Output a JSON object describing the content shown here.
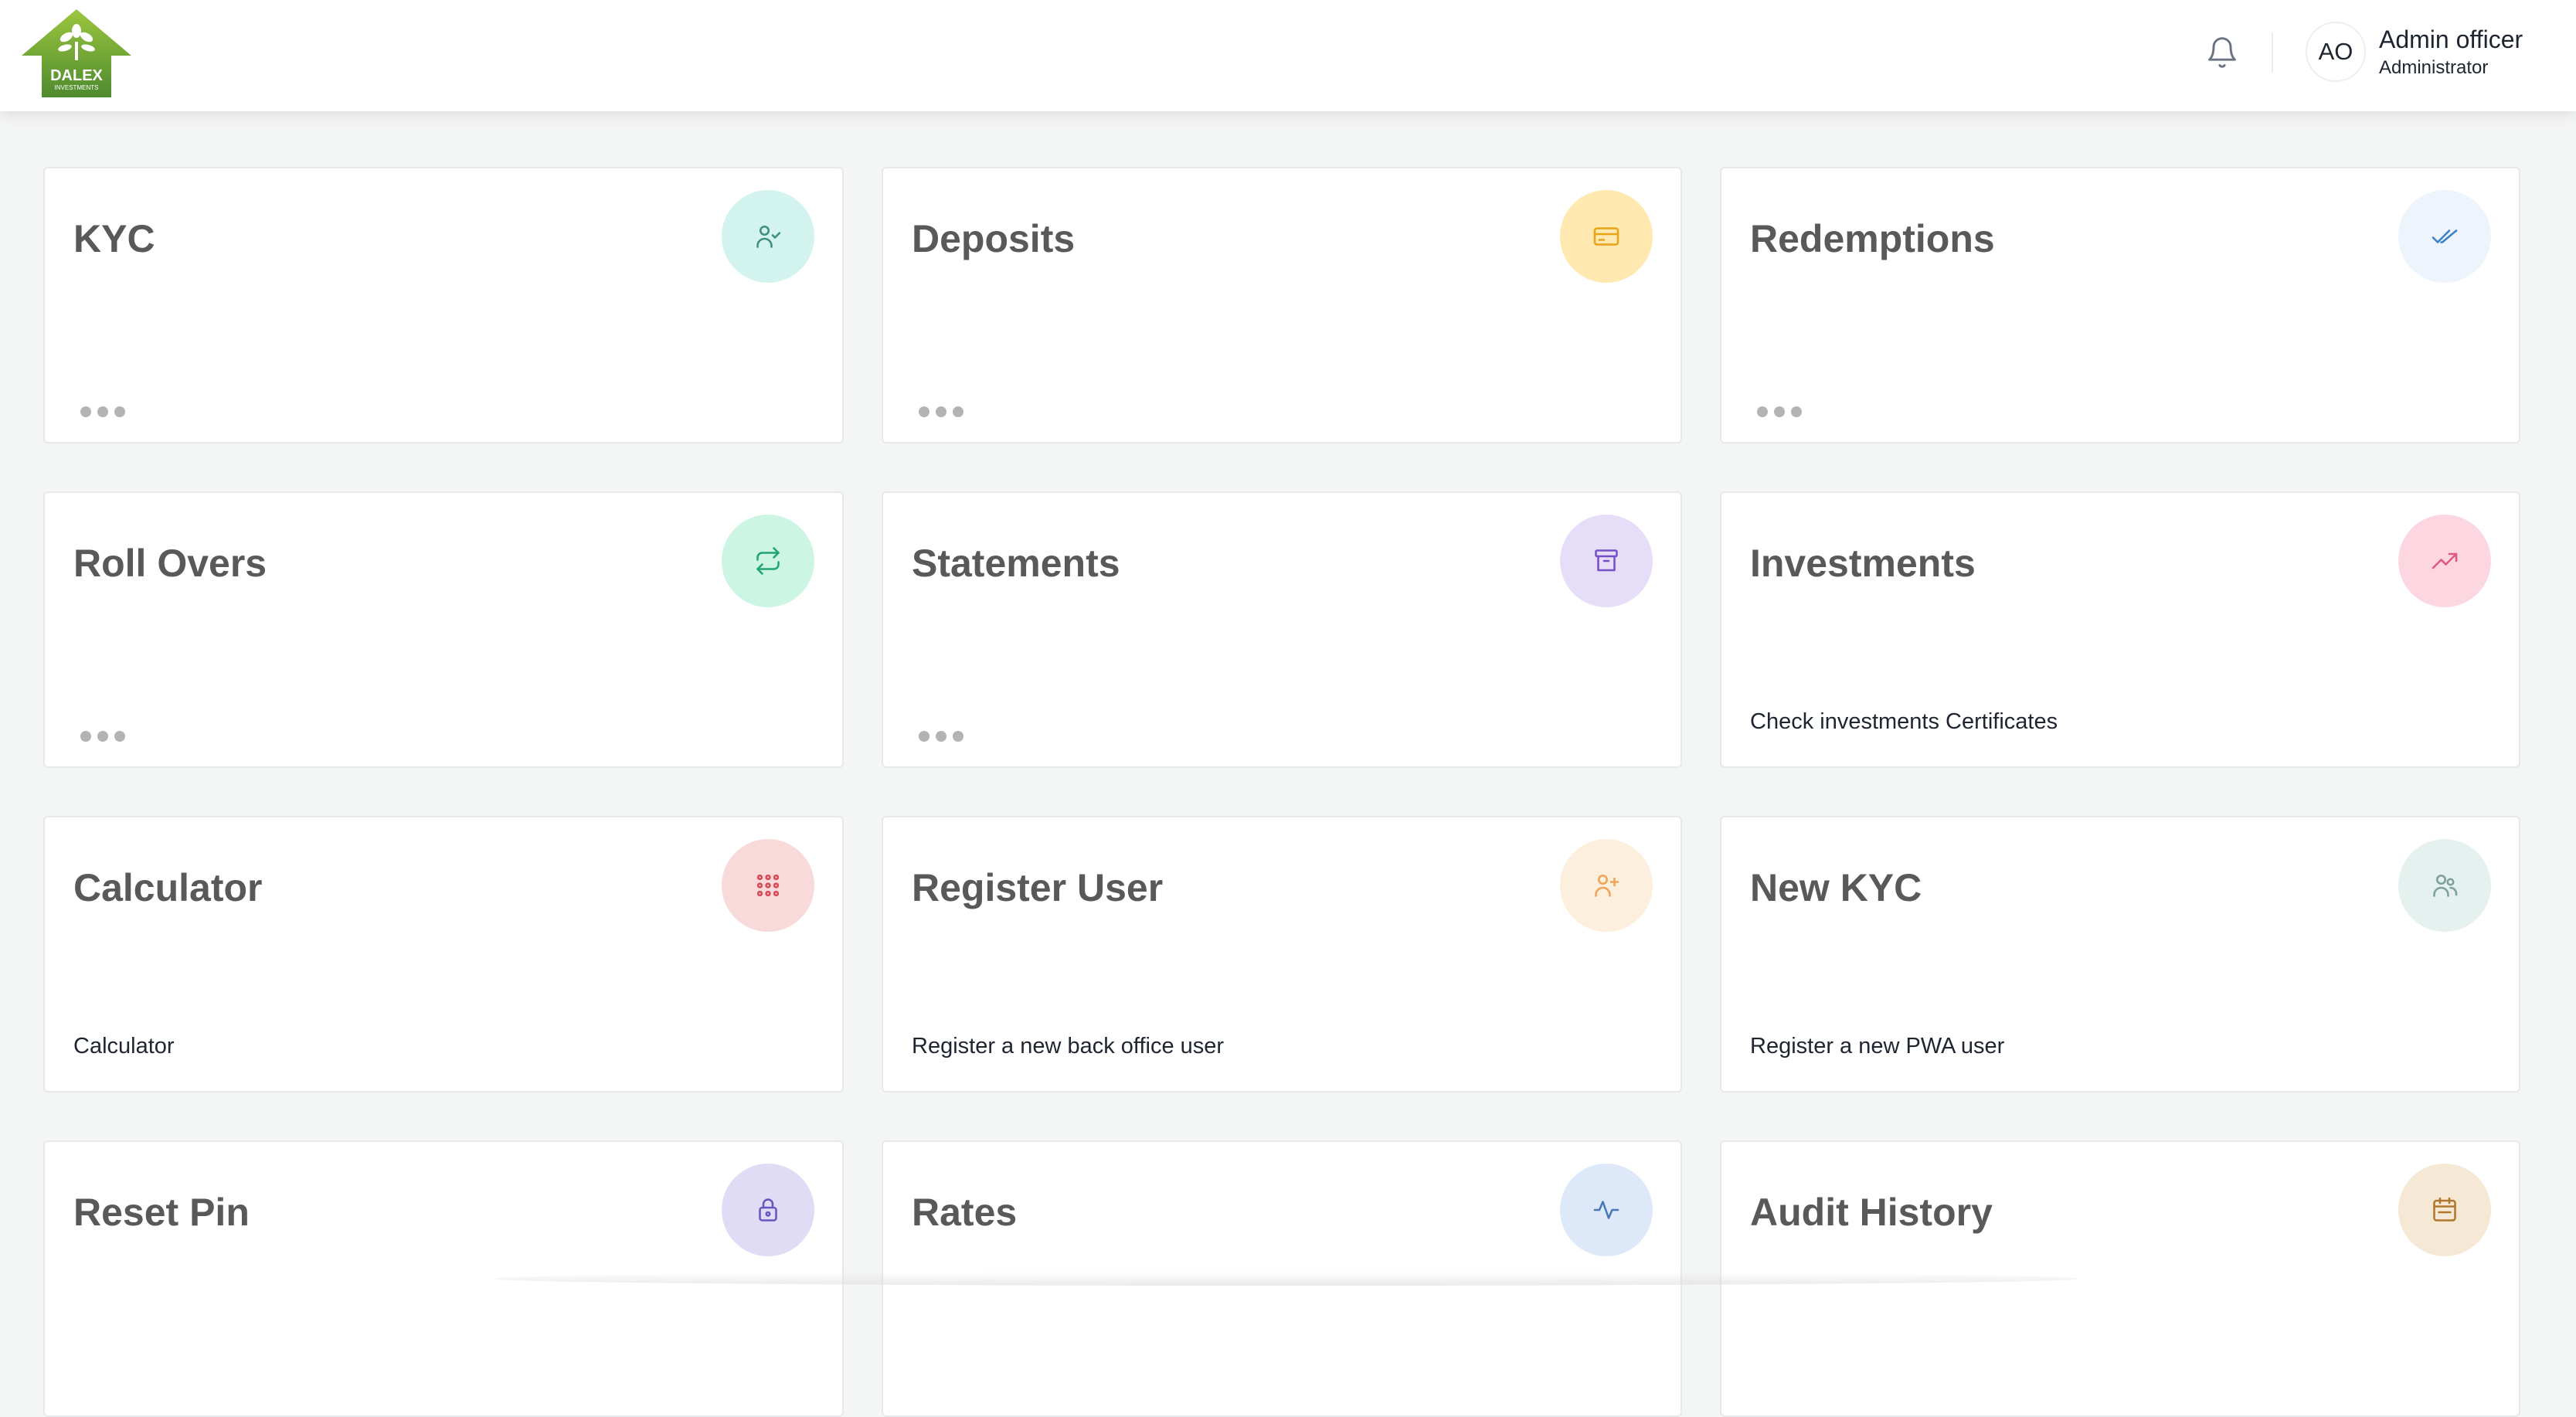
{
  "header": {
    "logo_text": "DALEX",
    "logo_subtext": "INVESTMENTS",
    "user": {
      "initials": "AO",
      "name": "Admin officer",
      "role": "Administrator"
    }
  },
  "cards": [
    {
      "title": "KYC",
      "icon": "user-check-icon",
      "icon_bg": "#d3f4ee",
      "icon_color": "#3e8f7f",
      "description": ""
    },
    {
      "title": "Deposits",
      "icon": "credit-card-icon",
      "icon_bg": "#ffe9b0",
      "icon_color": "#e8a317",
      "description": ""
    },
    {
      "title": "Redemptions",
      "icon": "double-check-icon",
      "icon_bg": "#eef4fc",
      "icon_color": "#3a80c8",
      "description": ""
    },
    {
      "title": "Roll Overs",
      "icon": "repeat-icon",
      "icon_bg": "#cdf5e3",
      "icon_color": "#1ea672",
      "description": ""
    },
    {
      "title": "Statements",
      "icon": "archive-icon",
      "icon_bg": "#e6def8",
      "icon_color": "#7650c8",
      "description": ""
    },
    {
      "title": "Investments",
      "icon": "trending-up-icon",
      "icon_bg": "#fcd7e2",
      "icon_color": "#e0577f",
      "description": "Check investments Certificates"
    },
    {
      "title": "Calculator",
      "icon": "grid-dots-icon",
      "icon_bg": "#f9dada",
      "icon_color": "#d94a56",
      "description": "Calculator"
    },
    {
      "title": "Register User",
      "icon": "user-plus-icon",
      "icon_bg": "#fdefdd",
      "icon_color": "#f0a455",
      "description": "Register a new back office user"
    },
    {
      "title": "New KYC",
      "icon": "users-icon",
      "icon_bg": "#e5f1ef",
      "icon_color": "#7f9f9a",
      "description": "Register a new PWA user"
    },
    {
      "title": "Reset Pin",
      "icon": "lock-icon",
      "icon_bg": "#e1dcf6",
      "icon_color": "#6a55c0",
      "description": ""
    },
    {
      "title": "Rates",
      "icon": "activity-icon",
      "icon_bg": "#dde9f8",
      "icon_color": "#4978b8",
      "description": ""
    },
    {
      "title": "Audit History",
      "icon": "calendar-icon",
      "icon_bg": "#f5e8d4",
      "icon_color": "#b0782e",
      "description": ""
    }
  ]
}
